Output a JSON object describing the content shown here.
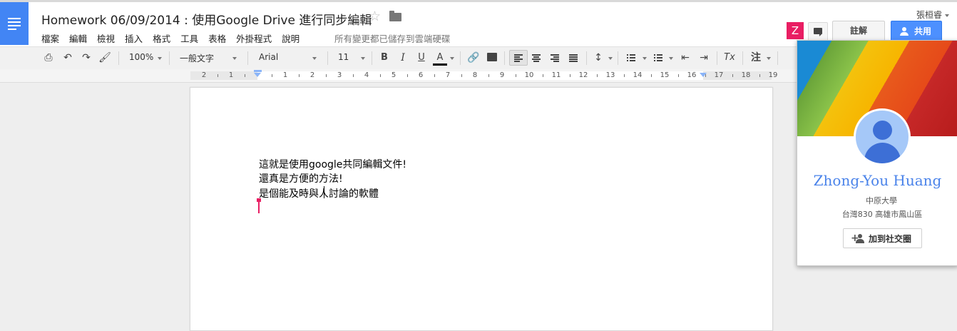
{
  "header": {
    "title": "Homework 06/09/2014 : 使用Google Drive 進行同步編輯",
    "save_status": "所有變更都已儲存到雲端硬碟",
    "user_name": "張桓睿",
    "collaborator_initial": "Z",
    "comments_label": "註解",
    "share_label": "共用"
  },
  "menu": {
    "items": [
      {
        "label": "檔案"
      },
      {
        "label": "編輯"
      },
      {
        "label": "檢視"
      },
      {
        "label": "插入"
      },
      {
        "label": "格式"
      },
      {
        "label": "工具"
      },
      {
        "label": "表格"
      },
      {
        "label": "外掛程式"
      },
      {
        "label": "說明"
      }
    ]
  },
  "toolbar": {
    "zoom": "100%",
    "style": "一般文字",
    "font": "Arial",
    "font_size": "11",
    "bold": "B",
    "italic": "I",
    "underline": "U",
    "text_color": "A",
    "clear_format": "Tx",
    "input_tools": "注",
    "text_color_value": "#000000"
  },
  "ruler": {
    "numbers": [
      "2",
      "1",
      "1",
      "2",
      "3",
      "4",
      "5",
      "6",
      "7",
      "8",
      "9",
      "10",
      "11",
      "12",
      "13",
      "14",
      "15",
      "16",
      "17",
      "18",
      "19"
    ]
  },
  "document": {
    "lines": [
      "這就是使用google共同編輯文件!",
      "還真是方便的方法!",
      "是個能及時與人討論的軟體"
    ]
  },
  "profile": {
    "name": "Zhong-You Huang",
    "organization": "中原大學",
    "location": "台灣830  高雄市鳳山區",
    "add_button": "加到社交圈"
  },
  "colors": {
    "accent": "#4285f4",
    "share_button": "#4d90fe",
    "collaborator": "#e91e63",
    "profile_name": "#4a83ea"
  }
}
